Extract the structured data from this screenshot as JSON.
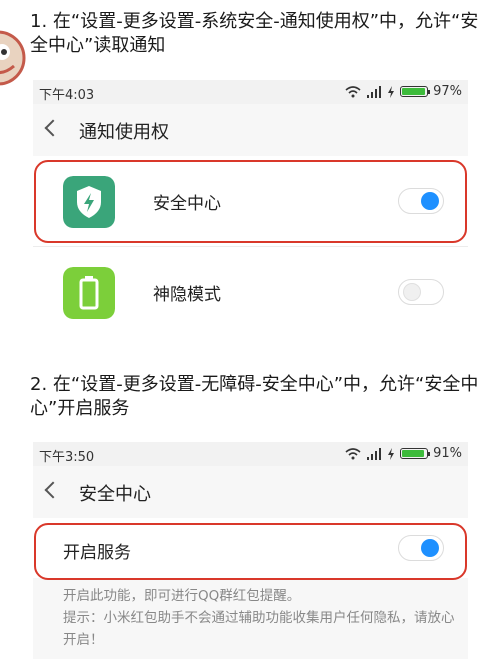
{
  "step1": {
    "title": "1. 在“设置-更多设置-系统安全-通知使用权”中，允许“安全中心”读取通知"
  },
  "screen1": {
    "status": {
      "time": "下午4:03",
      "battery": "97%",
      "battery_level": 0.97
    },
    "title": "通知使用权",
    "items": [
      {
        "label": "安全中心",
        "icon": "shield-lightning-icon",
        "icon_color": "#3aa57a",
        "enabled": true
      },
      {
        "label": "神隐模式",
        "icon": "battery-icon",
        "icon_color": "#7ccf3a",
        "enabled": false
      }
    ]
  },
  "step2": {
    "title": "2. 在“设置-更多设置-无障碍-安全中心”中，允许“安全中心”开启服务"
  },
  "screen2": {
    "status": {
      "time": "下午3:50",
      "battery": "91%",
      "battery_level": 0.91
    },
    "title": "安全中心",
    "service": {
      "label": "开启服务",
      "enabled": true
    },
    "desc_line1": "开启此功能，即可进行QQ群红包提醒。",
    "desc_line2": "提示：小米红包助手不会通过辅助功能收集用户任何隐私，请放心开启！"
  },
  "colors": {
    "highlight": "#d9382a",
    "toggle_on": "#1e90ff",
    "battery": "#3dbb3b"
  }
}
